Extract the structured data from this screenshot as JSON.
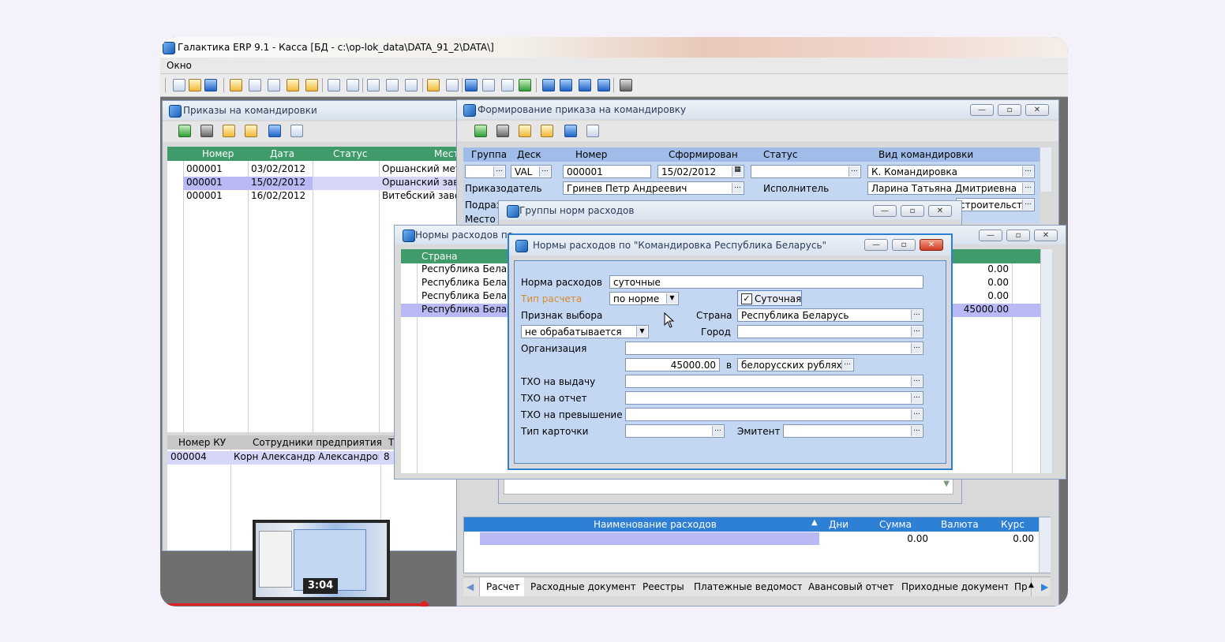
{
  "app": {
    "title": "Галактика ERP 9.1 - Касса [БД - c:\\op-lok_data\\DATA_91_2\\DATA\\]",
    "menu": [
      "Окно"
    ]
  },
  "orders_window": {
    "title": "Приказы на командировки",
    "columns": [
      "Номер",
      "Дата",
      "Статус",
      "Место"
    ],
    "rows": [
      {
        "num": "000001",
        "date": "03/02/2012",
        "status": "",
        "place": "Оршанский метиз"
      },
      {
        "num": "000001",
        "date": "15/02/2012",
        "status": "",
        "place": "Оршанский завод"
      },
      {
        "num": "000001",
        "date": "16/02/2012",
        "status": "",
        "place": "Витебский завод"
      }
    ],
    "sub_columns": [
      "Номер КУ",
      "Сотрудники предприятия",
      "Т"
    ],
    "sub_rows": [
      {
        "ku": "000004",
        "employee": "Корн Александр Александрович",
        "t": "8"
      }
    ],
    "thumbnail_time": "3:04"
  },
  "form_window": {
    "title": "Формирование приказа на командировку",
    "labels": {
      "group": "Группа",
      "desk": "Деск",
      "number": "Номер",
      "formed": "Сформирован",
      "status": "Статус",
      "trip_type": "Вид командировки",
      "issuer": "Приказодатель",
      "executor": "Исполнитель",
      "subdiv": "Подраз",
      "place": "Место"
    },
    "values": {
      "desk": "VAL",
      "number": "000001",
      "formed": "15/02/2012",
      "trip_type": "К. Командировка",
      "issuer": "Гринев Петр Андреевич",
      "executor": "Ларина Татьяна Дмитриевна",
      "subdiv_right": "строительства"
    },
    "expense_columns": [
      "Наименование расходов",
      "Дни",
      "Сумма",
      "Валюта",
      "Курс"
    ],
    "expense_row": {
      "sum": "0.00",
      "rate": "0.00"
    },
    "tabs": [
      "Расчет",
      "Расходные документы",
      "Реестры",
      "Платежные ведомости",
      "Авансовый отчет",
      "Приходные документы",
      "Пр"
    ]
  },
  "groups_window": {
    "title": "Группы норм расходов"
  },
  "norms_list_window": {
    "title": "Нормы расходов по",
    "columns": [
      "Страна"
    ],
    "rows": [
      {
        "country": "Республика Беларусь",
        "value": "0.00"
      },
      {
        "country": "Республика Беларусь",
        "value": "0.00"
      },
      {
        "country": "Республика Беларусь",
        "value": "0.00"
      },
      {
        "country": "Республика Беларусь",
        "value": "45000.00"
      }
    ]
  },
  "norm_dialog": {
    "title": "Нормы расходов по \"Командировка Республика Беларусь\"",
    "labels": {
      "norm": "Норма расходов",
      "calc_type": "Тип расчета",
      "choice_sign": "Признак выбора",
      "country": "Страна",
      "city": "Город",
      "organization": "Организация",
      "in": "в",
      "tho_issue": "ТХО на выдачу",
      "tho_report": "ТХО на отчет",
      "tho_excess": "ТХО на превышение",
      "card_type": "Тип карточки",
      "emitent": "Эмитент"
    },
    "values": {
      "norm": "суточные",
      "calc_type": "по норме",
      "daily_checkbox": "Суточная",
      "choice_sign": "не обрабатывается",
      "country": "Республика Беларусь",
      "city": "",
      "organization": "",
      "amount": "45000.00",
      "currency": "белорусских рублях",
      "tho_issue": "",
      "tho_report": "",
      "tho_excess": "",
      "card_type": "",
      "emitent": ""
    },
    "daily_checked": true
  },
  "colors": {
    "grid_header": "#3f9b6a",
    "blue_header": "#2e7fd6",
    "dialog_bg": "#c3d6f2",
    "selected_row": "#b9b9f5"
  }
}
